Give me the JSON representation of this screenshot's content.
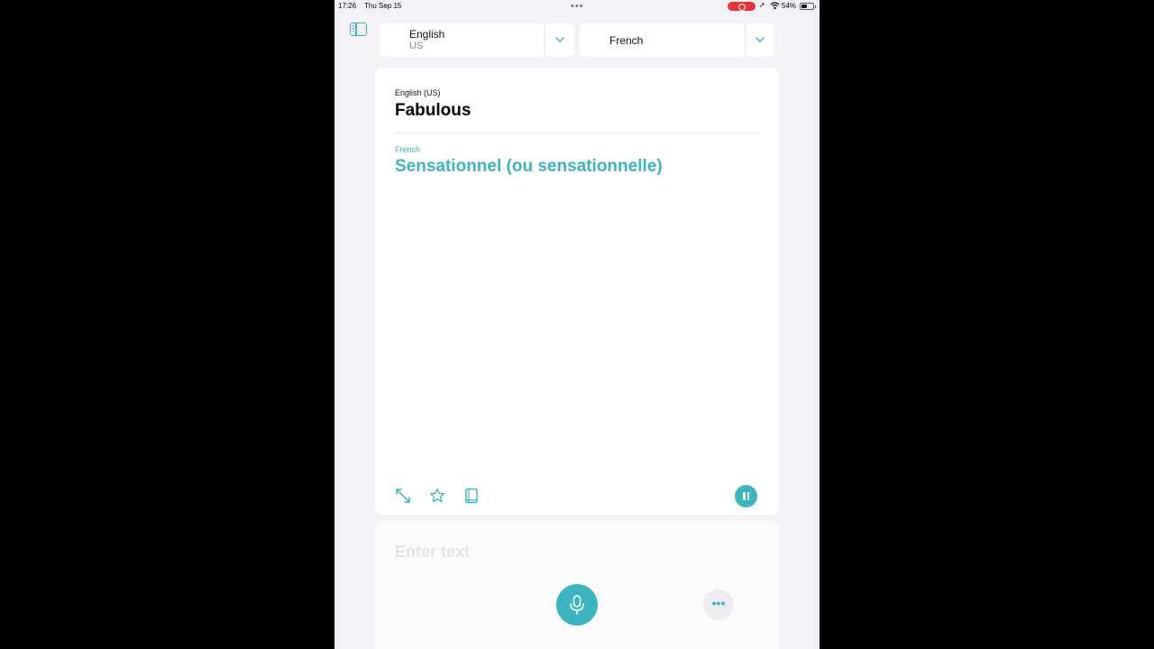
{
  "status_bar": {
    "time": "17:26",
    "date": "Thu Sep 15",
    "multitasking_dots": "•••",
    "battery_percent": "54%",
    "battery_level": 0.54,
    "recording_color": "#e3343b"
  },
  "languages": {
    "source": {
      "name": "English",
      "region": "US"
    },
    "target": {
      "name": "French"
    }
  },
  "translation": {
    "source_label": "English (US)",
    "source_text": "Fabulous",
    "target_label": "French",
    "target_text": "Sensationnel (ou sensationnelle)"
  },
  "input": {
    "placeholder": "Enter text",
    "more_glyph": "•••"
  },
  "colors": {
    "accent": "#3bb4bf",
    "background": "#f2f1f6",
    "card": "#ffffff"
  },
  "icons": {
    "sidebar": "sidebar-icon",
    "expand": "expand-icon",
    "favorite": "star-icon",
    "dictionary": "book-icon",
    "pause": "pause-icon",
    "microphone": "microphone-icon",
    "more": "more-icon",
    "chevron": "chevron-down-icon"
  }
}
